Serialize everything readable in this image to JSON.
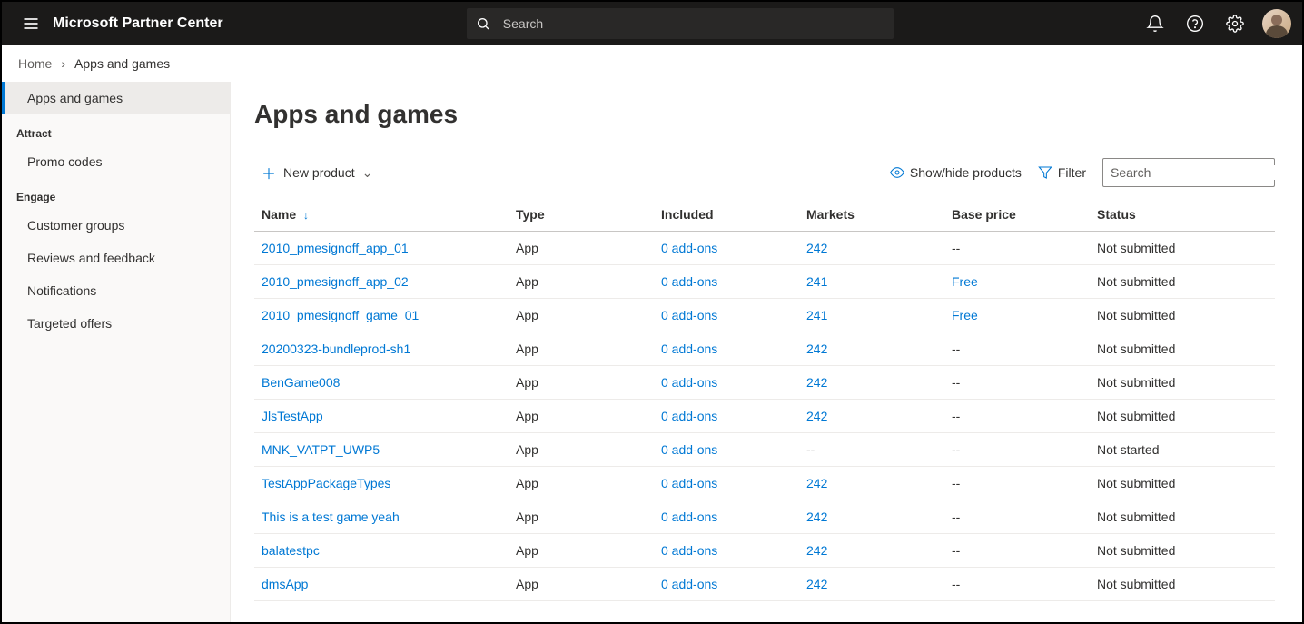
{
  "header": {
    "brand": "Microsoft Partner Center",
    "search_placeholder": "Search"
  },
  "breadcrumb": {
    "home": "Home",
    "current": "Apps and games"
  },
  "sidebar": {
    "active": "Apps and games",
    "sections": [
      {
        "title": "Attract",
        "items": [
          "Promo codes"
        ]
      },
      {
        "title": "Engage",
        "items": [
          "Customer groups",
          "Reviews and feedback",
          "Notifications",
          "Targeted offers"
        ]
      }
    ]
  },
  "page": {
    "title": "Apps and games",
    "new_product_label": "New product",
    "show_hide_label": "Show/hide products",
    "filter_label": "Filter",
    "table_search_placeholder": "Search"
  },
  "table": {
    "columns": [
      "Name",
      "Type",
      "Included",
      "Markets",
      "Base price",
      "Status"
    ],
    "sort_column": "Name",
    "rows": [
      {
        "name": "2010_pmesignoff_app_01",
        "type": "App",
        "included": "0 add-ons",
        "markets": "242",
        "price": "--",
        "status": "Not submitted"
      },
      {
        "name": "2010_pmesignoff_app_02",
        "type": "App",
        "included": "0 add-ons",
        "markets": "241",
        "price": "Free",
        "status": "Not submitted"
      },
      {
        "name": "2010_pmesignoff_game_01",
        "type": "App",
        "included": "0 add-ons",
        "markets": "241",
        "price": "Free",
        "status": "Not submitted"
      },
      {
        "name": "20200323-bundleprod-sh1",
        "type": "App",
        "included": "0 add-ons",
        "markets": "242",
        "price": "--",
        "status": "Not submitted"
      },
      {
        "name": "BenGame008",
        "type": "App",
        "included": "0 add-ons",
        "markets": "242",
        "price": "--",
        "status": "Not submitted"
      },
      {
        "name": "JlsTestApp",
        "type": "App",
        "included": "0 add-ons",
        "markets": "242",
        "price": "--",
        "status": "Not submitted"
      },
      {
        "name": "MNK_VATPT_UWP5",
        "type": "App",
        "included": "0 add-ons",
        "markets": "--",
        "price": "--",
        "status": "Not started"
      },
      {
        "name": "TestAppPackageTypes",
        "type": "App",
        "included": "0 add-ons",
        "markets": "242",
        "price": "--",
        "status": "Not submitted"
      },
      {
        "name": "This is a test game yeah",
        "type": "App",
        "included": "0 add-ons",
        "markets": "242",
        "price": "--",
        "status": "Not submitted"
      },
      {
        "name": "balatestpc",
        "type": "App",
        "included": "0 add-ons",
        "markets": "242",
        "price": "--",
        "status": "Not submitted"
      },
      {
        "name": "dmsApp",
        "type": "App",
        "included": "0 add-ons",
        "markets": "242",
        "price": "--",
        "status": "Not submitted"
      }
    ]
  }
}
